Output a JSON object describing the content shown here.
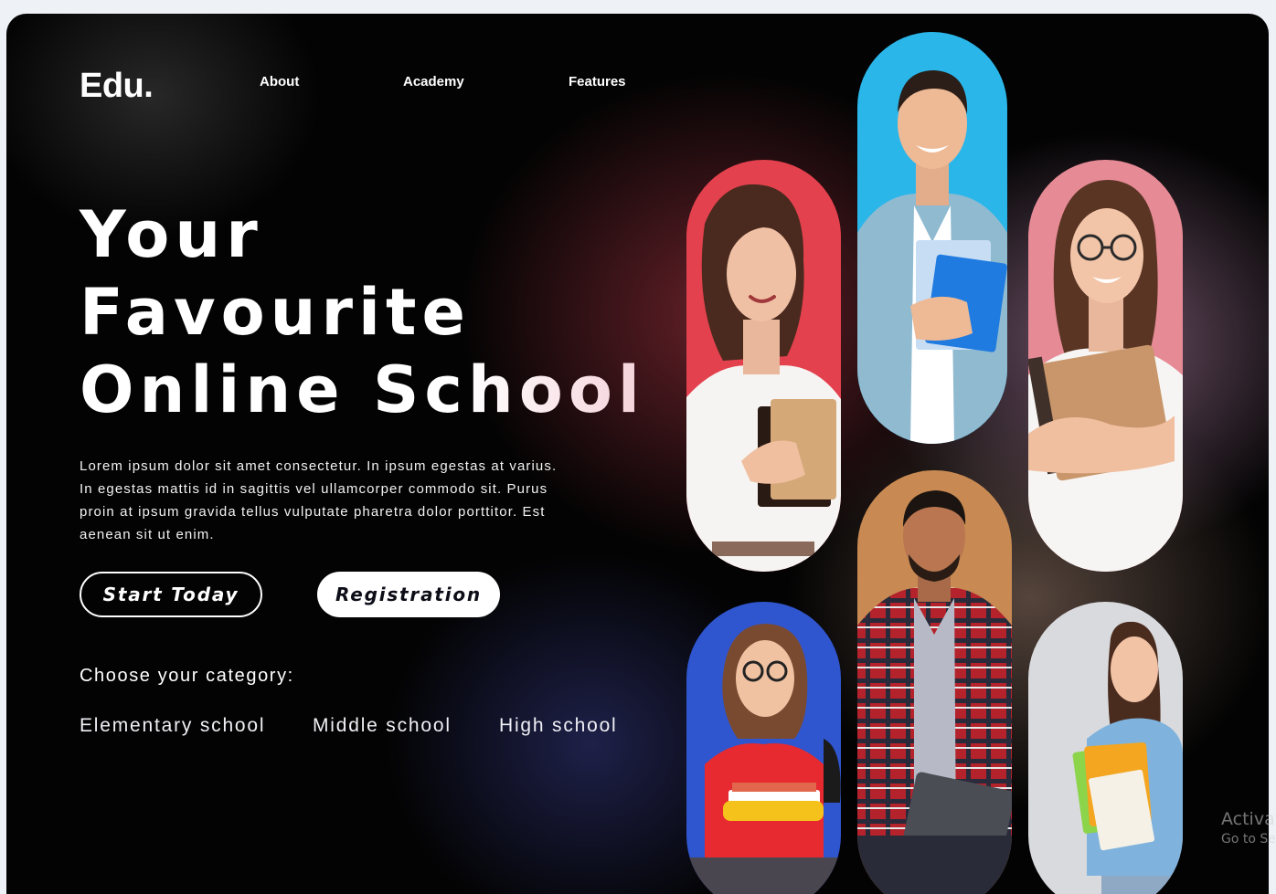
{
  "brand": {
    "logo": "Edu."
  },
  "nav": {
    "items": [
      {
        "label": "About"
      },
      {
        "label": "Academy"
      },
      {
        "label": "Features"
      }
    ]
  },
  "hero": {
    "title_lines": [
      "Your",
      "Favourite",
      "Online School"
    ],
    "description": "Lorem ipsum dolor sit amet consectetur. In ipsum egestas at varius. In egestas mattis id in sagittis vel ullamcorper commodo sit. Purus proin at ipsum gravida tellus vulputate pharetra dolor porttitor. Est aenean sit ut enim.",
    "primary_button": "Start Today",
    "secondary_button": "Registration"
  },
  "category": {
    "title": "Choose your category:",
    "options": [
      "Elementary school",
      "Middle school",
      "High school"
    ]
  },
  "gallery": {
    "photos": [
      {
        "name": "student-photo-woman-red",
        "bg": "#e3414d"
      },
      {
        "name": "student-photo-man-blue",
        "bg": "#2bb6ea"
      },
      {
        "name": "student-photo-woman-glasses-pink",
        "bg": "#e68a95"
      },
      {
        "name": "student-photo-girl-backpack",
        "bg": "#2f56cf"
      },
      {
        "name": "student-photo-man-plaid",
        "bg": "#c88a52"
      },
      {
        "name": "student-photo-girl-notebooks",
        "bg": "#d9dadd"
      }
    ]
  },
  "watermark": {
    "line1": "Activat",
    "line2": "Go to Set"
  },
  "colors": {
    "background": "#030303",
    "text": "#ffffff",
    "button_fill": "#ffffff"
  }
}
